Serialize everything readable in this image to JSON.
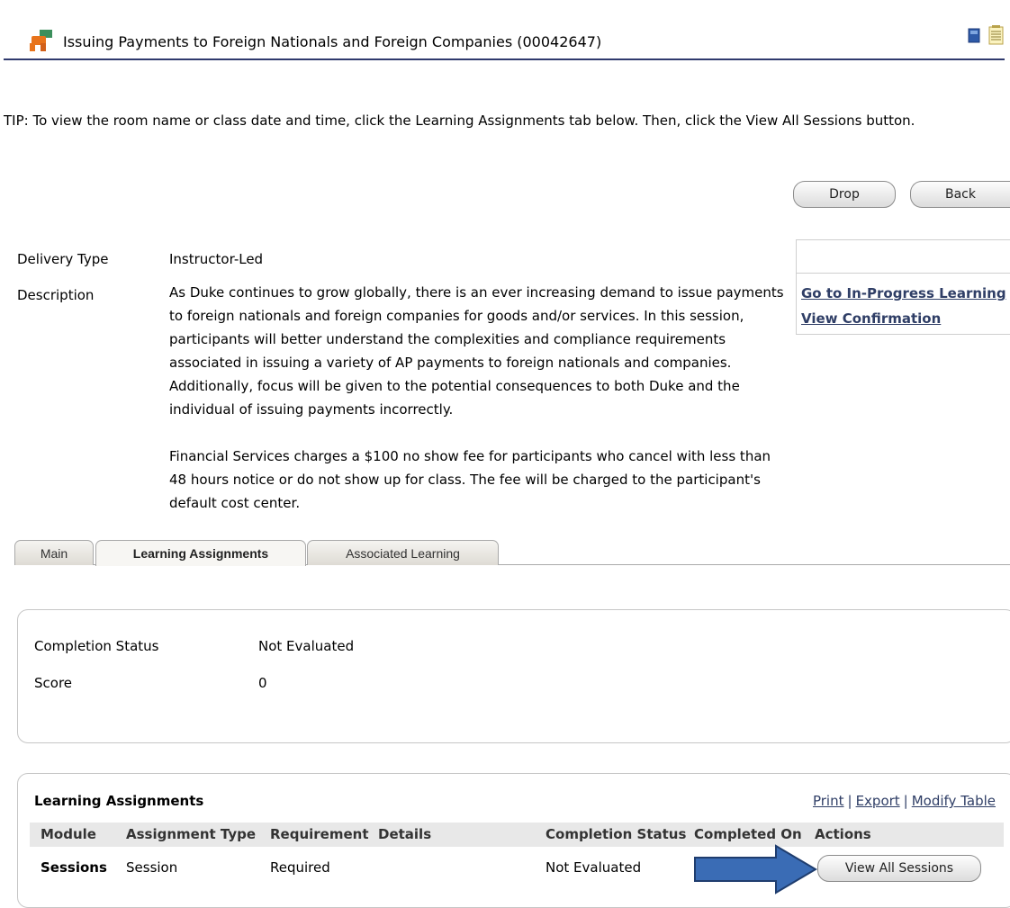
{
  "header": {
    "title": "Issuing Payments to Foreign Nationals and Foreign Companies (00042647)",
    "icon": "learning-item-icon"
  },
  "tip": "TIP: To view the room name or class date and time, click the Learning Assignments tab below. Then, click the View All Sessions button.",
  "actions": {
    "drop_label": "Drop",
    "back_label": "Back"
  },
  "details": {
    "delivery_type_label": "Delivery Type",
    "delivery_type_value": "Instructor-Led",
    "description_label": "Description",
    "description_p1": "As Duke continues to grow globally, there is an ever increasing demand to issue payments to foreign nationals and foreign companies for goods and/or services. In this session, participants will better understand the complexities and compliance requirements associated in issuing a variety of AP payments to foreign nationals and companies. Additionally, focus will be given to the potential consequences to both Duke and the individual of issuing payments incorrectly.",
    "description_p2": "Financial Services charges a $100 no show fee for participants who cancel with less than 48 hours notice or do not show up for class. The fee will be charged to the participant's default cost center."
  },
  "side_links": {
    "in_progress": "Go to In-Progress Learning",
    "confirmation": "View Confirmation"
  },
  "tabs": {
    "main": "Main",
    "learning_assignments": "Learning Assignments",
    "associated_learning": "Associated Learning",
    "active": "Learning Assignments"
  },
  "completion": {
    "status_label": "Completion Status",
    "status_value": "Not Evaluated",
    "score_label": "Score",
    "score_value": "0"
  },
  "assignments": {
    "title": "Learning Assignments",
    "links": {
      "print": "Print",
      "export": "Export",
      "modify": "Modify Table",
      "separator": "|"
    },
    "columns": {
      "module": "Module",
      "assignment_type": "Assignment Type",
      "requirement": "Requirement",
      "details": "Details",
      "completion_status": "Completion Status",
      "completed_on": "Completed On",
      "actions": "Actions"
    },
    "rows": [
      {
        "module": "Sessions",
        "assignment_type": "Session",
        "requirement": "Required",
        "details": "",
        "completion_status": "Not Evaluated",
        "completed_on": "",
        "action_label": "View All Sessions"
      }
    ]
  },
  "colors": {
    "title_rule": "#2f3a6e",
    "link": "#2f3e66",
    "arrow": "#3a6cb5",
    "arrow_border": "#1f3d6e"
  }
}
